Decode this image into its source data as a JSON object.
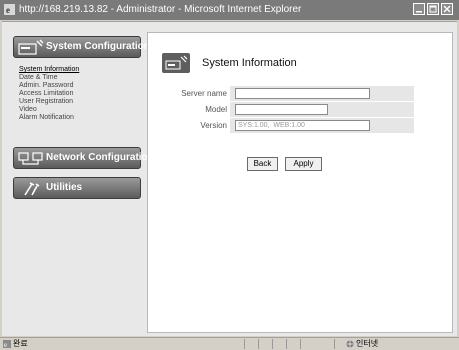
{
  "window": {
    "title": "http://168.219.13.82 - Administrator - Microsoft Internet Explorer"
  },
  "sidebar": {
    "system_configuration": "System Configuration",
    "submenu": [
      "System Information",
      "Date & Time",
      "Admin. Password",
      "Access Limitation",
      "User Registration",
      "Video",
      "Alarm Notification"
    ],
    "network_configuration": "Network Configuration",
    "utilities": "Utilities"
  },
  "content": {
    "title": "System Information",
    "fields": {
      "server_name_label": "Server name",
      "server_name_value": "",
      "model_label": "Model",
      "model_value": "",
      "version_label": "Version",
      "version_value": "SYS:1.00,  WEB:1.00"
    },
    "back_label": "Back",
    "apply_label": "Apply"
  },
  "statusbar": {
    "text": "완료",
    "zone": "인터넷"
  },
  "icons": {
    "ie": "internet-explorer-icon",
    "sys": "system-config-icon",
    "net": "network-config-icon",
    "utl": "utilities-wrench-icon",
    "page": "system-info-icon"
  }
}
